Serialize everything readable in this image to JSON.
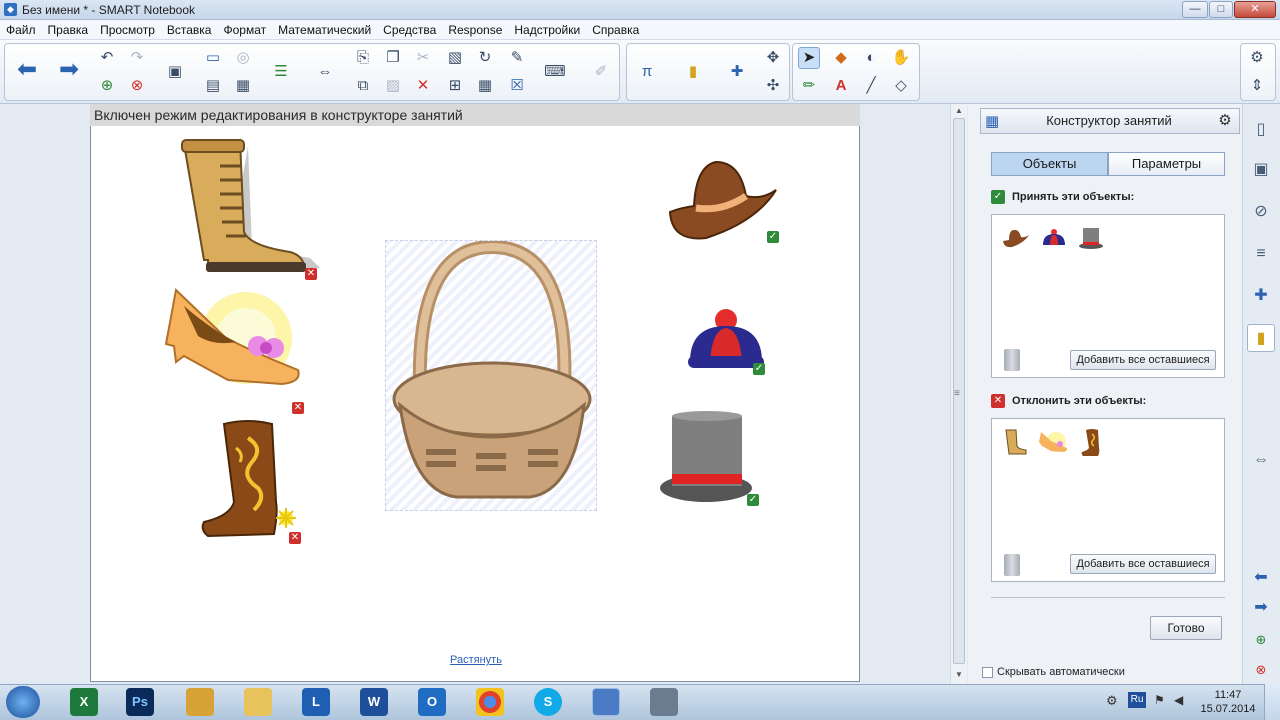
{
  "window": {
    "title": "Без имени * - SMART Notebook",
    "controls": {
      "minimize": "—",
      "maximize": "□",
      "close": "✕"
    }
  },
  "menu": [
    "Файл",
    "Правка",
    "Просмотр",
    "Вставка",
    "Формат",
    "Математический",
    "Средства",
    "Response",
    "Надстройки",
    "Справка"
  ],
  "canvas": {
    "banner": "Включен режим редактирования в конструкторе занятий",
    "stretch_link": "Растянуть",
    "items": [
      {
        "name": "lace-up boot",
        "status": "reject"
      },
      {
        "name": "high-heel shoe",
        "status": "reject"
      },
      {
        "name": "cowboy boot",
        "status": "reject"
      },
      {
        "name": "cowboy hat",
        "status": "accept"
      },
      {
        "name": "winter beanie",
        "status": "accept"
      },
      {
        "name": "top hat",
        "status": "accept"
      },
      {
        "name": "basket",
        "status": "target"
      }
    ]
  },
  "panel": {
    "title": "Конструктор занятий",
    "tabs": [
      "Объекты",
      "Параметры"
    ],
    "accept_section": {
      "title": "Принять эти объекты:",
      "add_button": "Добавить все оставшиеся"
    },
    "reject_section": {
      "title": "Отклонить эти объекты:",
      "add_button": "Добавить все оставшиеся"
    },
    "done_button": "Готово",
    "autohide_label": "Скрывать автоматически"
  },
  "taskbar": {
    "apps": [
      "X",
      "Ps",
      "",
      "",
      "L",
      "W",
      "O",
      "",
      "S",
      "",
      ""
    ],
    "language": "Ru",
    "time": "11:47",
    "date": "15.07.2014"
  },
  "colors": {
    "accept": "#2e8b3a",
    "reject": "#d0302b",
    "accent": "#2b63b0",
    "basket": "#c9a27a"
  }
}
